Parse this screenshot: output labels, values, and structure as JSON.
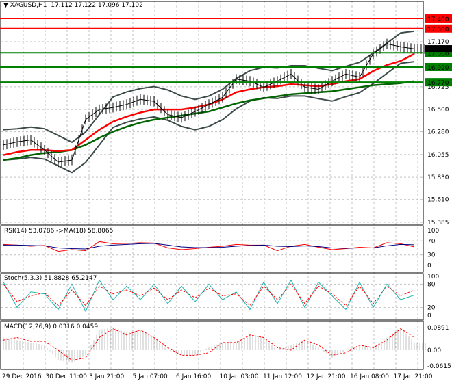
{
  "header": {
    "symbol": "XAGUSD,H1",
    "ohlc": "17.112 17.122 17.096 17.102"
  },
  "colors": {
    "resistance": "#ff0000",
    "support": "#008000",
    "ma_fast": "#ff0000",
    "ma_slow": "#006400",
    "bands": "#3c4a4a",
    "rsi": "#ff0000",
    "rsi_ma": "#000080",
    "stoch_main": "#20b2aa",
    "stoch_signal": "#ff0000",
    "macd_hist": "#c0c0c0",
    "macd_signal": "#ff0000"
  },
  "chart_data": [
    {
      "type": "line",
      "title": "XAGUSD,H1",
      "ylim": [
        15.385,
        17.45
      ],
      "price_ticks": [
        "17.170",
        "16.725",
        "16.500",
        "16.280",
        "16.055",
        "15.830",
        "15.610",
        "15.385"
      ],
      "current_price": "17.102",
      "levels": [
        {
          "value": 17.4,
          "label": "17.400",
          "kind": "resistance"
        },
        {
          "value": 17.3,
          "label": "17.300",
          "kind": "resistance"
        },
        {
          "value": 17.06,
          "label": "17.060",
          "kind": "support"
        },
        {
          "value": 16.92,
          "label": "16.920",
          "kind": "support"
        },
        {
          "value": 16.77,
          "label": "16.770",
          "kind": "support"
        }
      ],
      "x_labels": [
        "29 Dec 2016",
        "30 Dec 11:00",
        "3 Jan 21:00",
        "5 Jan 07:00",
        "6 Jan 16:00",
        "10 Jan 03:00",
        "11 Jan 12:00",
        "12 Jan 21:00",
        "16 Jan 08:00",
        "17 Jan 21:00"
      ],
      "close": [
        16.15,
        16.18,
        16.2,
        16.1,
        15.98,
        16.0,
        16.4,
        16.5,
        16.52,
        16.55,
        16.6,
        16.58,
        16.45,
        16.42,
        16.48,
        16.55,
        16.62,
        16.8,
        16.78,
        16.72,
        16.78,
        16.85,
        16.72,
        16.7,
        16.78,
        16.85,
        16.82,
        17.05,
        17.15,
        17.12,
        17.1
      ],
      "ma_fast": [
        16.05,
        16.08,
        16.1,
        16.1,
        16.09,
        16.1,
        16.2,
        16.3,
        16.38,
        16.43,
        16.47,
        16.5,
        16.5,
        16.5,
        16.52,
        16.55,
        16.6,
        16.67,
        16.7,
        16.72,
        16.73,
        16.75,
        16.74,
        16.73,
        16.75,
        16.78,
        16.8,
        16.88,
        16.94,
        16.98,
        17.05
      ],
      "ma_slow": [
        16.0,
        16.02,
        16.05,
        16.07,
        16.08,
        16.1,
        16.15,
        16.22,
        16.28,
        16.33,
        16.37,
        16.4,
        16.42,
        16.44,
        16.46,
        16.48,
        16.52,
        16.56,
        16.59,
        16.61,
        16.63,
        16.65,
        16.66,
        16.67,
        16.68,
        16.7,
        16.72,
        16.74,
        16.75,
        16.76,
        16.78
      ]
    },
    {
      "type": "line",
      "title": "RSI(14) 53.0786  ->MA(18) 58.8065",
      "ylim": [
        0,
        100
      ],
      "ticks": [
        "100",
        "70",
        "30",
        "0"
      ],
      "rsi": [
        60,
        58,
        55,
        57,
        40,
        45,
        42,
        68,
        62,
        63,
        65,
        64,
        50,
        45,
        48,
        52,
        55,
        60,
        58,
        58,
        42,
        55,
        60,
        52,
        45,
        48,
        52,
        50,
        65,
        62,
        53
      ],
      "ma": [
        58,
        58,
        57,
        56,
        50,
        48,
        47,
        55,
        58,
        60,
        62,
        63,
        58,
        53,
        51,
        51,
        52,
        55,
        57,
        58,
        55,
        54,
        56,
        54,
        50,
        49,
        50,
        50,
        56,
        60,
        59
      ]
    },
    {
      "type": "line",
      "title": "Stoch(5,3,3) 51.8828 65.2147",
      "ylim": [
        0,
        100
      ],
      "ticks": [
        "100",
        "80",
        "20",
        "0"
      ],
      "main": [
        85,
        20,
        60,
        55,
        15,
        80,
        10,
        90,
        40,
        75,
        40,
        80,
        30,
        75,
        35,
        80,
        40,
        60,
        15,
        85,
        30,
        90,
        20,
        85,
        50,
        15,
        85,
        20,
        80,
        40,
        52
      ],
      "signal": [
        80,
        35,
        50,
        58,
        25,
        65,
        25,
        75,
        55,
        65,
        50,
        70,
        40,
        65,
        45,
        70,
        50,
        55,
        25,
        75,
        40,
        80,
        30,
        75,
        55,
        25,
        75,
        30,
        75,
        50,
        65
      ]
    },
    {
      "type": "bar",
      "title": "MACD(12,26,9) 0.0316 0.0459",
      "ylim": [
        -0.0615,
        0.0891
      ],
      "ticks": [
        "0.0891",
        "0.00",
        "-0.0615"
      ],
      "hist": [
        0.05,
        0.04,
        0.03,
        0.02,
        -0.04,
        -0.05,
        -0.02,
        0.08,
        0.09,
        0.07,
        0.08,
        0.05,
        0.0,
        -0.02,
        -0.02,
        0.01,
        0.03,
        0.03,
        0.06,
        0.05,
        0.0,
        0.02,
        0.04,
        0.01,
        -0.03,
        0.0,
        0.02,
        0.01,
        0.05,
        0.09,
        0.03
      ],
      "signal": [
        0.04,
        0.05,
        0.035,
        0.035,
        0.0,
        -0.04,
        -0.03,
        0.05,
        0.085,
        0.06,
        0.08,
        0.05,
        0.01,
        -0.02,
        -0.02,
        -0.01,
        0.03,
        0.03,
        0.06,
        0.05,
        0.01,
        0.0,
        0.04,
        0.02,
        -0.02,
        -0.01,
        0.02,
        0.01,
        0.04,
        0.085,
        0.05
      ]
    }
  ]
}
